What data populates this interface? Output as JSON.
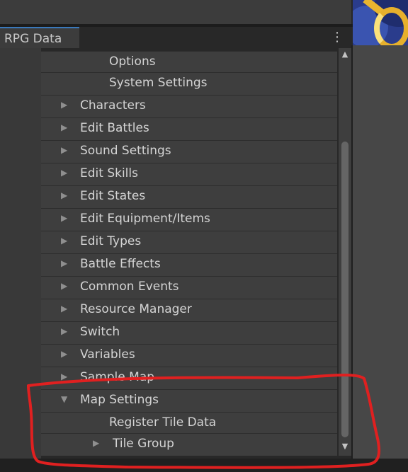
{
  "tab": {
    "label": "RPG Data"
  },
  "menu_icon": "kebab-menu-icon",
  "scroll": {
    "up_icon": "scroll-up-arrow-icon",
    "down_icon": "scroll-down-arrow-icon"
  },
  "rows": [
    {
      "label": "Options",
      "level": 2,
      "arrow": "none"
    },
    {
      "label": "System Settings",
      "level": 2,
      "arrow": "none"
    },
    {
      "label": "Characters",
      "level": 1,
      "arrow": "collapsed"
    },
    {
      "label": "Edit Battles",
      "level": 1,
      "arrow": "collapsed"
    },
    {
      "label": "Sound Settings",
      "level": 1,
      "arrow": "collapsed"
    },
    {
      "label": "Edit Skills",
      "level": 1,
      "arrow": "collapsed"
    },
    {
      "label": "Edit States",
      "level": 1,
      "arrow": "collapsed"
    },
    {
      "label": "Edit Equipment/Items",
      "level": 1,
      "arrow": "collapsed"
    },
    {
      "label": "Edit Types",
      "level": 1,
      "arrow": "collapsed"
    },
    {
      "label": "Battle Effects",
      "level": 1,
      "arrow": "collapsed"
    },
    {
      "label": "Common Events",
      "level": 1,
      "arrow": "collapsed"
    },
    {
      "label": "Resource Manager",
      "level": 1,
      "arrow": "collapsed"
    },
    {
      "label": "Switch",
      "level": 1,
      "arrow": "collapsed"
    },
    {
      "label": "Variables",
      "level": 1,
      "arrow": "collapsed"
    },
    {
      "label": "Sample Map",
      "level": 1,
      "arrow": "collapsed"
    },
    {
      "label": "Map Settings",
      "level": 1,
      "arrow": "expanded"
    },
    {
      "label": "Register Tile Data",
      "level": 2,
      "arrow": "none"
    },
    {
      "label": "Tile Group",
      "level": 2,
      "arrow": "collapsed"
    }
  ],
  "colors": {
    "background": "#282828",
    "row": "#3e3e3e",
    "text": "#d4d4d4",
    "tab_accent": "#3a79bb",
    "annotation": "#e02020"
  }
}
